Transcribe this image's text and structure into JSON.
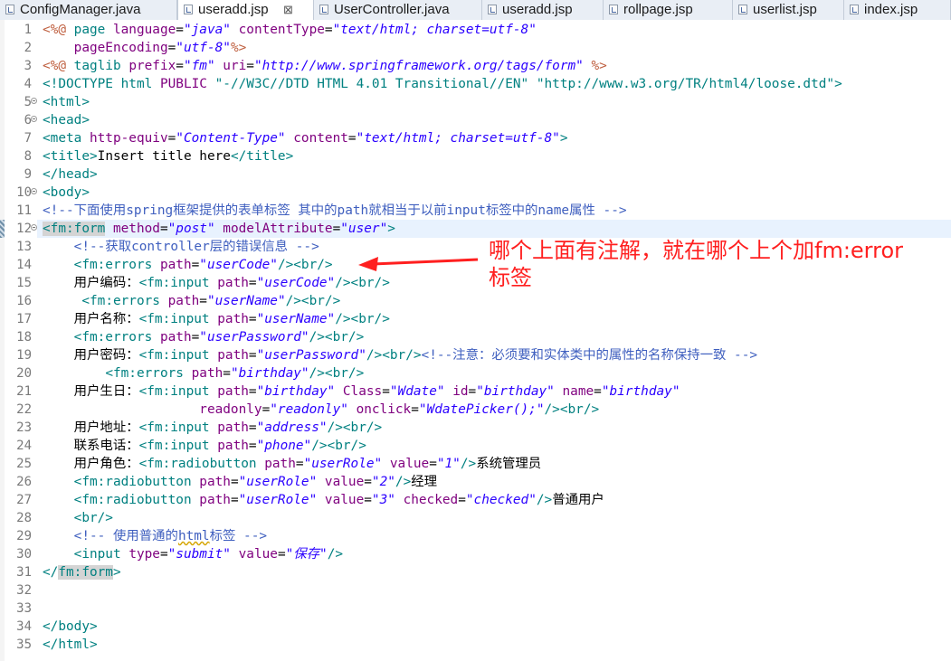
{
  "tabs": [
    {
      "label": "ConfigManager.java",
      "icon": "java-file-icon"
    },
    {
      "label": "useradd.jsp",
      "icon": "jsp-file-icon",
      "active": true,
      "close": "⊠"
    },
    {
      "label": "UserController.java",
      "icon": "java-file-icon"
    },
    {
      "label": "useradd.jsp",
      "icon": "jsp-file-icon"
    },
    {
      "label": "rollpage.jsp",
      "icon": "jsp-file-icon"
    },
    {
      "label": "userlist.jsp",
      "icon": "jsp-file-icon"
    },
    {
      "label": "index.jsp",
      "icon": "jsp-file-icon"
    }
  ],
  "editor": {
    "current_line": 12,
    "folding_lines": [
      5,
      6,
      10,
      12
    ],
    "lines": [
      [
        [
          "<%@ ",
          "dir"
        ],
        [
          "page ",
          "tg"
        ],
        [
          "language",
          "an"
        ],
        [
          "=",
          ""
        ],
        [
          "\"java\"",
          "av"
        ],
        [
          " contentType",
          "an"
        ],
        [
          "=",
          ""
        ],
        [
          "\"text/html; charset=utf-8\"",
          "av"
        ]
      ],
      [
        [
          "    pageEncoding",
          "an"
        ],
        [
          "=",
          ""
        ],
        [
          "\"utf-8\"",
          "av"
        ],
        [
          "%>",
          "dir"
        ]
      ],
      [
        [
          "<%@ ",
          "dir"
        ],
        [
          "taglib ",
          "tg"
        ],
        [
          "prefix",
          "an"
        ],
        [
          "=",
          ""
        ],
        [
          "\"fm\"",
          "av"
        ],
        [
          " uri",
          "an"
        ],
        [
          "=",
          ""
        ],
        [
          "\"http://www.springframework.org/tags/form\"",
          "av"
        ],
        [
          " %>",
          "dir"
        ]
      ],
      [
        [
          "<!DOCTYPE html ",
          "tg"
        ],
        [
          "PUBLIC ",
          "an"
        ],
        [
          "\"-//W3C//DTD HTML 4.01 Transitional//EN\"",
          "tg"
        ],
        [
          " ",
          ""
        ],
        [
          "\"http://www.w3.org/TR/html4/loose.dtd\"",
          "tg"
        ],
        [
          ">",
          "tg"
        ]
      ],
      [
        [
          "<html>",
          "tg"
        ]
      ],
      [
        [
          "<head>",
          "tg"
        ]
      ],
      [
        [
          "<meta ",
          "tg"
        ],
        [
          "http-equiv",
          "an"
        ],
        [
          "=",
          ""
        ],
        [
          "\"Content-Type\"",
          "av"
        ],
        [
          " content",
          "an"
        ],
        [
          "=",
          ""
        ],
        [
          "\"text/html; charset=utf-8\"",
          "av"
        ],
        [
          ">",
          "tg"
        ]
      ],
      [
        [
          "<title>",
          "tg"
        ],
        [
          "Insert title here",
          ""
        ],
        [
          "</title>",
          "tg"
        ]
      ],
      [
        [
          "</head>",
          "tg"
        ]
      ],
      [
        [
          "<body>",
          "tg"
        ]
      ],
      [
        [
          "<!--下面使用spring框架提供的表单标签 其中的path就相当于以前input标签中的name属性 -->",
          "cm"
        ]
      ],
      [
        [
          "<fm:form",
          "tg hl"
        ],
        [
          " method",
          "an"
        ],
        [
          "=",
          ""
        ],
        [
          "\"post\"",
          "av"
        ],
        [
          " modelAttribute",
          "an"
        ],
        [
          "=",
          ""
        ],
        [
          "\"user\"",
          "av"
        ],
        [
          ">",
          "tg"
        ]
      ],
      [
        [
          "    ",
          ""
        ],
        [
          "<!--获取controller层的错误信息 -->",
          "cm"
        ]
      ],
      [
        [
          "    ",
          ""
        ],
        [
          "<fm:errors ",
          "tg"
        ],
        [
          "path",
          "an"
        ],
        [
          "=",
          ""
        ],
        [
          "\"userCode\"",
          "av"
        ],
        [
          "/><br/>",
          "tg"
        ]
      ],
      [
        [
          "    用户编码：",
          ""
        ],
        [
          "<fm:input ",
          "tg"
        ],
        [
          "path",
          "an"
        ],
        [
          "=",
          ""
        ],
        [
          "\"userCode\"",
          "av"
        ],
        [
          "/><br/>",
          "tg"
        ]
      ],
      [
        [
          "     ",
          ""
        ],
        [
          "<fm:errors ",
          "tg"
        ],
        [
          "path",
          "an"
        ],
        [
          "=",
          ""
        ],
        [
          "\"userName\"",
          "av"
        ],
        [
          "/><br/>",
          "tg"
        ]
      ],
      [
        [
          "    用户名称：",
          ""
        ],
        [
          "<fm:input ",
          "tg"
        ],
        [
          "path",
          "an"
        ],
        [
          "=",
          ""
        ],
        [
          "\"userName\"",
          "av"
        ],
        [
          "/><br/>",
          "tg"
        ]
      ],
      [
        [
          "    ",
          ""
        ],
        [
          "<fm:errors ",
          "tg"
        ],
        [
          "path",
          "an"
        ],
        [
          "=",
          ""
        ],
        [
          "\"userPassword\"",
          "av"
        ],
        [
          "/><br/>",
          "tg"
        ]
      ],
      [
        [
          "    用户密码：",
          ""
        ],
        [
          "<fm:input ",
          "tg"
        ],
        [
          "path",
          "an"
        ],
        [
          "=",
          ""
        ],
        [
          "\"userPassword\"",
          "av"
        ],
        [
          "/><br/>",
          "tg"
        ],
        [
          "<!--注意：必须要和实体类中的属性的名称保持一致 -->",
          "cm"
        ]
      ],
      [
        [
          "        ",
          ""
        ],
        [
          "<fm:errors ",
          "tg"
        ],
        [
          "path",
          "an"
        ],
        [
          "=",
          ""
        ],
        [
          "\"birthday\"",
          "av"
        ],
        [
          "/><br/>",
          "tg"
        ]
      ],
      [
        [
          "    用户生日：",
          ""
        ],
        [
          "<fm:input ",
          "tg"
        ],
        [
          "path",
          "an"
        ],
        [
          "=",
          ""
        ],
        [
          "\"birthday\"",
          "av"
        ],
        [
          " Class",
          "an"
        ],
        [
          "=",
          ""
        ],
        [
          "\"Wdate\"",
          "av"
        ],
        [
          " id",
          "an"
        ],
        [
          "=",
          ""
        ],
        [
          "\"birthday\"",
          "av"
        ],
        [
          " name",
          "an"
        ],
        [
          "=",
          ""
        ],
        [
          "\"birthday\"",
          "av"
        ]
      ],
      [
        [
          "                    readonly",
          "an"
        ],
        [
          "=",
          ""
        ],
        [
          "\"readonly\"",
          "av"
        ],
        [
          " onclick",
          "an"
        ],
        [
          "=",
          ""
        ],
        [
          "\"WdatePicker();\"",
          "av"
        ],
        [
          "/><br/>",
          "tg"
        ]
      ],
      [
        [
          "    用户地址：",
          ""
        ],
        [
          "<fm:input ",
          "tg"
        ],
        [
          "path",
          "an"
        ],
        [
          "=",
          ""
        ],
        [
          "\"address\"",
          "av"
        ],
        [
          "/><br/>",
          "tg"
        ]
      ],
      [
        [
          "    联系电话：",
          ""
        ],
        [
          "<fm:input ",
          "tg"
        ],
        [
          "path",
          "an"
        ],
        [
          "=",
          ""
        ],
        [
          "\"phone\"",
          "av"
        ],
        [
          "/><br/>",
          "tg"
        ]
      ],
      [
        [
          "    用户角色：",
          ""
        ],
        [
          "<fm:radiobutton ",
          "tg"
        ],
        [
          "path",
          "an"
        ],
        [
          "=",
          ""
        ],
        [
          "\"userRole\"",
          "av"
        ],
        [
          " value",
          "an"
        ],
        [
          "=",
          ""
        ],
        [
          "\"1\"",
          "av"
        ],
        [
          "/>",
          "tg"
        ],
        [
          "系统管理员",
          ""
        ]
      ],
      [
        [
          "    ",
          ""
        ],
        [
          "<fm:radiobutton ",
          "tg"
        ],
        [
          "path",
          "an"
        ],
        [
          "=",
          ""
        ],
        [
          "\"userRole\"",
          "av"
        ],
        [
          " value",
          "an"
        ],
        [
          "=",
          ""
        ],
        [
          "\"2\"",
          "av"
        ],
        [
          "/>",
          "tg"
        ],
        [
          "经理",
          ""
        ]
      ],
      [
        [
          "    ",
          ""
        ],
        [
          "<fm:radiobutton ",
          "tg"
        ],
        [
          "path",
          "an"
        ],
        [
          "=",
          ""
        ],
        [
          "\"userRole\"",
          "av"
        ],
        [
          " value",
          "an"
        ],
        [
          "=",
          ""
        ],
        [
          "\"3\"",
          "av"
        ],
        [
          " checked",
          "an"
        ],
        [
          "=",
          ""
        ],
        [
          "\"checked\"",
          "av"
        ],
        [
          "/>",
          "tg"
        ],
        [
          "普通用户",
          ""
        ]
      ],
      [
        [
          "    ",
          ""
        ],
        [
          "<br/>",
          "tg"
        ]
      ],
      [
        [
          "    ",
          ""
        ],
        [
          "<!-- 使用普通的",
          "cm"
        ],
        [
          "html",
          "cm sq"
        ],
        [
          "标签 -->",
          "cm"
        ]
      ],
      [
        [
          "    ",
          ""
        ],
        [
          "<input ",
          "tg"
        ],
        [
          "type",
          "an"
        ],
        [
          "=",
          ""
        ],
        [
          "\"submit\"",
          "av"
        ],
        [
          " value",
          "an"
        ],
        [
          "=",
          ""
        ],
        [
          "\"保存\"",
          "av"
        ],
        [
          "/>",
          "tg"
        ]
      ],
      [
        [
          "</",
          "tg"
        ],
        [
          "fm:form",
          "tg hl"
        ],
        [
          ">",
          "tg"
        ]
      ],
      [],
      [],
      [
        [
          "</body>",
          "tg"
        ]
      ],
      [
        [
          "</html>",
          "tg"
        ]
      ]
    ]
  },
  "annotation": {
    "line1": "哪个上面有注解，就在哪个上个加fm:error",
    "line2": "标签",
    "color": "#ff1f1f"
  },
  "colors": {
    "tag": "#008080",
    "attribute": "#7f007f",
    "value": "#2a00ff",
    "comment": "#3f5fbf",
    "directive": "#bf5f3f",
    "current_line": "#e8f2fe"
  }
}
